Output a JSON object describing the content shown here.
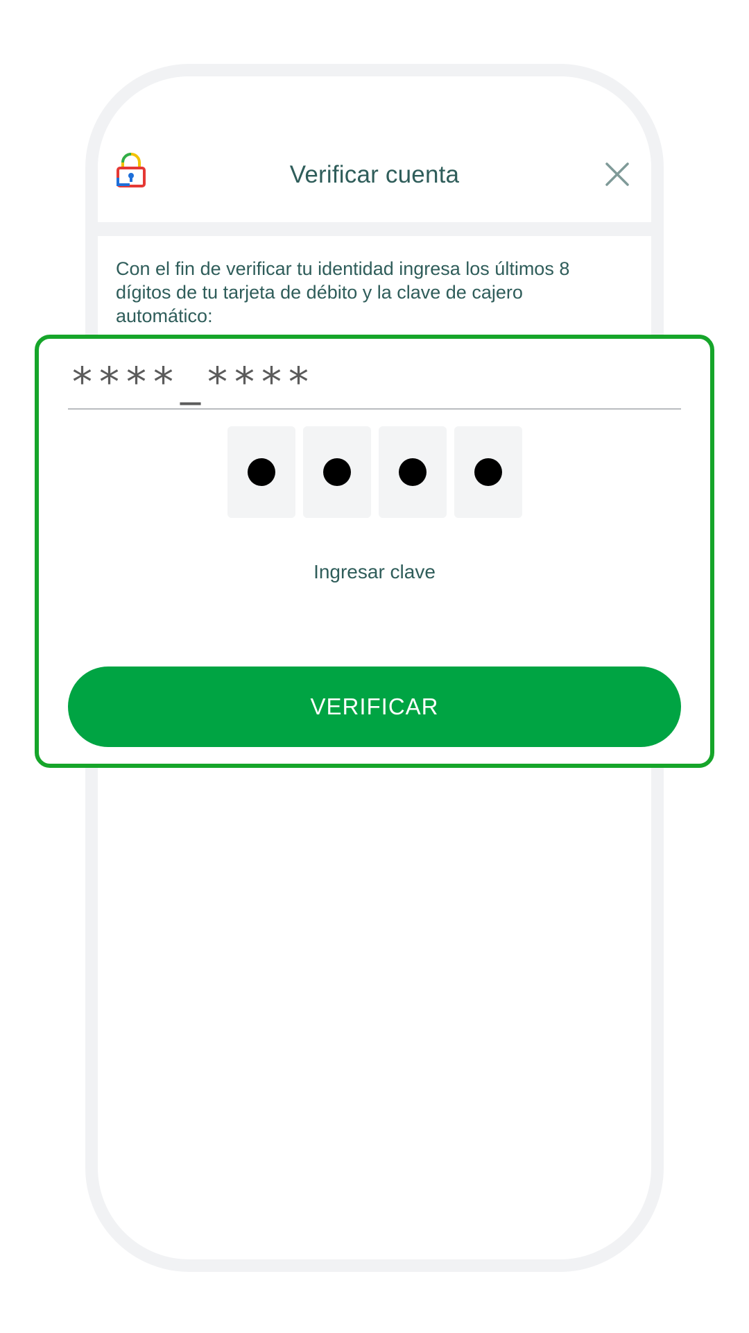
{
  "header": {
    "title": "Verificar cuenta",
    "lock_icon": "lock-icon",
    "close_icon": "close-icon"
  },
  "description": "Con el fin de verificar tu identidad ingresa los últimos 8 dígitos de tu tarjeta de débito y la clave de cajero automático:",
  "card_field": {
    "value": "****_****"
  },
  "pin": {
    "digits_filled": 4,
    "digits_total": 4,
    "label": "Ingresar clave"
  },
  "verify_button": {
    "label": "VERIFICAR"
  },
  "colors": {
    "accent_green": "#00a443",
    "highlight_green": "#16a52a",
    "text_teal": "#2f5d5a"
  }
}
